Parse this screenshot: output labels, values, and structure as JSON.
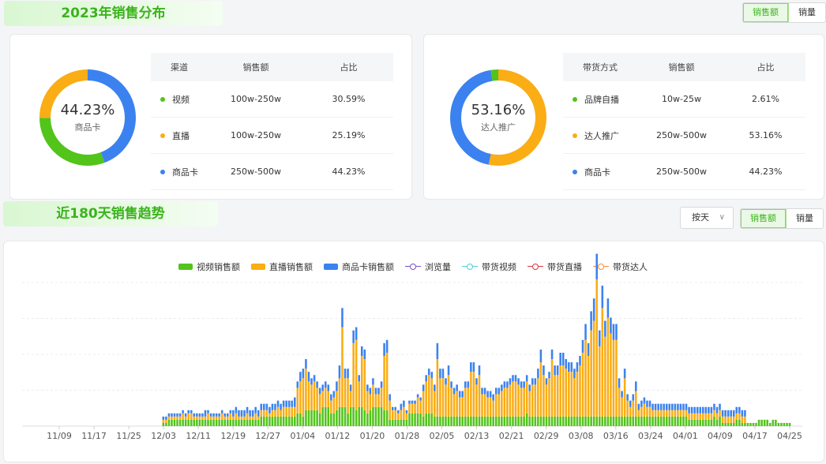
{
  "header": {
    "title": "2023年销售分布",
    "toggle": [
      "销售额",
      "销量"
    ]
  },
  "distribution": [
    {
      "center_pct": "44.23%",
      "center_label": "商品卡",
      "columns": [
        "渠道",
        "销售额",
        "占比"
      ],
      "rows": [
        {
          "name": "视频",
          "amount": "100w-250w",
          "pct": "30.59%",
          "color": "#52c41a"
        },
        {
          "name": "直播",
          "amount": "100w-250w",
          "pct": "25.19%",
          "color": "#faad14"
        },
        {
          "name": "商品卡",
          "amount": "250w-500w",
          "pct": "44.23%",
          "color": "#3b82f0"
        }
      ]
    },
    {
      "center_pct": "53.16%",
      "center_label": "达人推广",
      "columns": [
        "带货方式",
        "销售额",
        "占比"
      ],
      "rows": [
        {
          "name": "品牌自播",
          "amount": "10w-25w",
          "pct": "2.61%",
          "color": "#52c41a"
        },
        {
          "name": "达人推广",
          "amount": "250w-500w",
          "pct": "53.16%",
          "color": "#faad14"
        },
        {
          "name": "商品卡",
          "amount": "250w-500w",
          "pct": "44.23%",
          "color": "#3b82f0"
        }
      ]
    }
  ],
  "trend": {
    "title": "近180天销售趋势",
    "period": "按天",
    "toggle": [
      "销售额",
      "销量"
    ]
  },
  "chart_data": {
    "type": "bar",
    "x_ticks": [
      "11/09",
      "11/17",
      "11/25",
      "12/03",
      "12/11",
      "12/19",
      "12/27",
      "01/04",
      "01/12",
      "01/20",
      "01/28",
      "02/05",
      "02/13",
      "02/21",
      "02/29",
      "03/08",
      "03/16",
      "03/24",
      "04/01",
      "04/09",
      "04/17",
      "04/25"
    ],
    "legend": [
      {
        "name": "视频销售额",
        "kind": "bar",
        "color": "#52c41a"
      },
      {
        "name": "直播销售额",
        "kind": "bar",
        "color": "#faad14"
      },
      {
        "name": "商品卡销售额",
        "kind": "bar",
        "color": "#3b82f0"
      },
      {
        "name": "浏览量",
        "kind": "line",
        "color": "#7b4fc9"
      },
      {
        "name": "带货视频",
        "kind": "line",
        "color": "#4fd0d6"
      },
      {
        "name": "带货直播",
        "kind": "line",
        "color": "#d9363e"
      },
      {
        "name": "带货达人",
        "kind": "line",
        "color": "#fa8c3c"
      }
    ],
    "series": [
      {
        "name": "视频销售额",
        "values": [
          0,
          0,
          0,
          0,
          0,
          0,
          0,
          0,
          0,
          0,
          0,
          0,
          0,
          0,
          0,
          0,
          0,
          0,
          0,
          0,
          0,
          0,
          0,
          0,
          0,
          0,
          0,
          0,
          0,
          0,
          0,
          0,
          0,
          0,
          0,
          0,
          0,
          0,
          0,
          0,
          0,
          0,
          0,
          0,
          0,
          0,
          0,
          0,
          0,
          0,
          1,
          1,
          2,
          2,
          2,
          2,
          2,
          2,
          2,
          2,
          2,
          2,
          2,
          2,
          2,
          2,
          2,
          2,
          2,
          2,
          2,
          2,
          2,
          2,
          2,
          2,
          2,
          2,
          2,
          2,
          2,
          2,
          2,
          2,
          2,
          3,
          3,
          3,
          3,
          3,
          3,
          3,
          3,
          3,
          3,
          3,
          3,
          3,
          4,
          4,
          3,
          5,
          5,
          5,
          5,
          5,
          4,
          6,
          6,
          6,
          4,
          4,
          5,
          6,
          6,
          6,
          4,
          6,
          6,
          5,
          6,
          6,
          5,
          4,
          5,
          6,
          6,
          6,
          6,
          5,
          5,
          2,
          2,
          2,
          2,
          2,
          2,
          2,
          4,
          4,
          4,
          4,
          4,
          3,
          4,
          4,
          4,
          3,
          3,
          3,
          3,
          3,
          3,
          3,
          3,
          3,
          3,
          3,
          3,
          3,
          3,
          3,
          3,
          3,
          3,
          3,
          3,
          3,
          3,
          3,
          3,
          3,
          3,
          3,
          3,
          3,
          3,
          3,
          3,
          3,
          4,
          3,
          3,
          3,
          3,
          3,
          3,
          3,
          3,
          3,
          3,
          3,
          3,
          3,
          3,
          3,
          3,
          3,
          3,
          3,
          3,
          3,
          3,
          3,
          3,
          3,
          3,
          3,
          3,
          3,
          3,
          3,
          3,
          3,
          3,
          3,
          3,
          3,
          3,
          3,
          3,
          3,
          3,
          3,
          3,
          3,
          3,
          3,
          3,
          3,
          3,
          3,
          3,
          3,
          3,
          3,
          3,
          3,
          2,
          2,
          2,
          2,
          2,
          2,
          2,
          2,
          2,
          3,
          2,
          3,
          1,
          1,
          1,
          1,
          1,
          2,
          2,
          1,
          1,
          1,
          1,
          1,
          1,
          2,
          2,
          2,
          2,
          1,
          2,
          2,
          1,
          1,
          1,
          1,
          1,
          0,
          0,
          0,
          0
        ]
      },
      {
        "name": "直播销售额",
        "values": [
          0,
          0,
          0,
          0,
          0,
          0,
          0,
          0,
          0,
          0,
          0,
          0,
          0,
          0,
          0,
          0,
          0,
          0,
          0,
          0,
          0,
          0,
          0,
          0,
          0,
          0,
          0,
          0,
          0,
          0,
          0,
          0,
          0,
          0,
          0,
          0,
          0,
          0,
          0,
          0,
          0,
          0,
          0,
          0,
          0,
          0,
          0,
          0,
          0,
          0,
          1,
          1,
          1,
          1,
          1,
          1,
          1,
          2,
          1,
          2,
          2,
          1,
          1,
          1,
          1,
          1,
          2,
          1,
          1,
          1,
          1,
          2,
          1,
          1,
          2,
          1,
          2,
          1,
          1,
          1,
          2,
          1,
          1,
          2,
          1,
          2,
          2,
          2,
          1,
          2,
          2,
          3,
          2,
          3,
          3,
          3,
          3,
          3,
          8,
          10,
          12,
          13,
          9,
          8,
          9,
          7,
          6,
          5,
          6,
          5,
          4,
          5,
          6,
          9,
          25,
          9,
          11,
          5,
          20,
          22,
          8,
          16,
          16,
          7,
          5,
          7,
          4,
          4,
          6,
          17,
          18,
          6,
          3,
          3,
          2,
          3,
          4,
          2,
          3,
          3,
          3,
          5,
          4,
          8,
          10,
          12,
          11,
          8,
          18,
          12,
          12,
          10,
          13,
          9,
          7,
          8,
          6,
          6,
          9,
          9,
          14,
          14,
          10,
          13,
          7,
          7,
          6,
          6,
          5,
          7,
          7,
          8,
          9,
          9,
          10,
          11,
          11,
          10,
          9,
          9,
          10,
          8,
          10,
          10,
          12,
          17,
          13,
          10,
          12,
          18,
          13,
          13,
          16,
          16,
          15,
          14,
          14,
          12,
          14,
          16,
          20,
          24,
          19,
          27,
          30,
          43,
          22,
          34,
          25,
          31,
          26,
          24,
          24,
          9,
          6,
          12,
          5,
          3,
          5,
          8,
          2,
          3,
          4,
          3,
          3,
          2,
          2,
          2,
          2,
          2,
          2,
          2,
          2,
          2,
          2,
          2,
          2,
          2,
          2,
          2,
          2,
          2,
          2,
          2,
          2,
          2,
          2,
          2,
          2,
          2,
          2,
          2,
          2,
          2,
          2,
          2,
          2,
          2,
          2
        ]
      },
      {
        "name": "商品卡销售额",
        "values": [
          0,
          0,
          0,
          0,
          0,
          0,
          0,
          0,
          0,
          0,
          0,
          0,
          0,
          0,
          0,
          0,
          0,
          0,
          0,
          0,
          0,
          0,
          0,
          0,
          0,
          0,
          0,
          0,
          0,
          0,
          0,
          0,
          0,
          0,
          0,
          0,
          0,
          0,
          0,
          0,
          0,
          0,
          0,
          0,
          0,
          0,
          0,
          0,
          0,
          0,
          1,
          1,
          1,
          1,
          1,
          1,
          1,
          1,
          1,
          1,
          1,
          1,
          1,
          1,
          1,
          2,
          1,
          1,
          1,
          1,
          1,
          1,
          1,
          1,
          1,
          2,
          2,
          2,
          2,
          2,
          2,
          2,
          2,
          2,
          2,
          2,
          2,
          2,
          2,
          2,
          2,
          2,
          2,
          2,
          2,
          2,
          2,
          3,
          2,
          3,
          3,
          3,
          3,
          2,
          2,
          2,
          2,
          2,
          2,
          2,
          2,
          2,
          3,
          4,
          6,
          3,
          3,
          2,
          4,
          4,
          2,
          3,
          3,
          2,
          2,
          2,
          2,
          2,
          2,
          4,
          4,
          2,
          1,
          1,
          1,
          2,
          2,
          1,
          1,
          1,
          1,
          1,
          1,
          2,
          2,
          2,
          2,
          2,
          5,
          3,
          3,
          2,
          3,
          2,
          2,
          2,
          2,
          2,
          2,
          2,
          3,
          3,
          2,
          3,
          2,
          2,
          2,
          2,
          2,
          2,
          2,
          2,
          2,
          2,
          2,
          2,
          2,
          2,
          2,
          2,
          2,
          2,
          2,
          2,
          3,
          4,
          3,
          2,
          2,
          3,
          3,
          3,
          4,
          4,
          3,
          3,
          3,
          3,
          3,
          3,
          4,
          5,
          4,
          6,
          7,
          8,
          5,
          7,
          5,
          6,
          5,
          5,
          5,
          3,
          2,
          3,
          2,
          2,
          2,
          3,
          2,
          2,
          2,
          2,
          2,
          2,
          2,
          2,
          2,
          2,
          2,
          2,
          2,
          2,
          2,
          2,
          2,
          2,
          2,
          2,
          2,
          2,
          2,
          2,
          2,
          2,
          2,
          2,
          2,
          2,
          2,
          2,
          2,
          2,
          2,
          2,
          2,
          2,
          2
        ]
      }
    ]
  }
}
